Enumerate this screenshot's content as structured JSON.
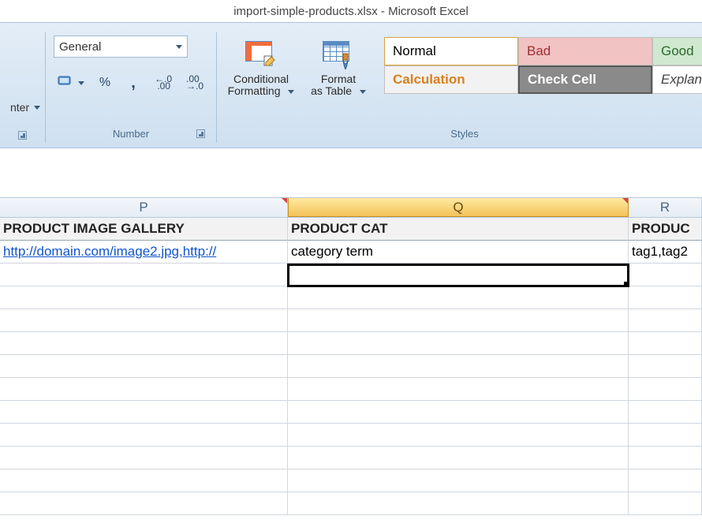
{
  "title": "import-simple-products.xlsx - Microsoft Excel",
  "ribbon": {
    "alignment": {
      "merge_center_label": "nter",
      "group_label": ""
    },
    "number": {
      "format_value": "General",
      "group_label": "Number"
    },
    "styles": {
      "conditional_formatting_label": "Conditional\nFormatting",
      "format_as_table_label": "Format\nas Table",
      "gallery": {
        "normal": "Normal",
        "bad": "Bad",
        "good": "Good",
        "calc": "Calculation",
        "check": "Check Cell",
        "explan": "Explan"
      },
      "group_label": "Styles"
    }
  },
  "columns": {
    "p": "P",
    "q": "Q",
    "r": "R"
  },
  "header_row": {
    "p": "PRODUCT IMAGE GALLERY",
    "q": "PRODUCT CAT",
    "r": "PRODUC"
  },
  "data_row1": {
    "p": "http://domain.com/image2.jpg,http://",
    "q": "category term",
    "r": "tag1,tag2"
  }
}
